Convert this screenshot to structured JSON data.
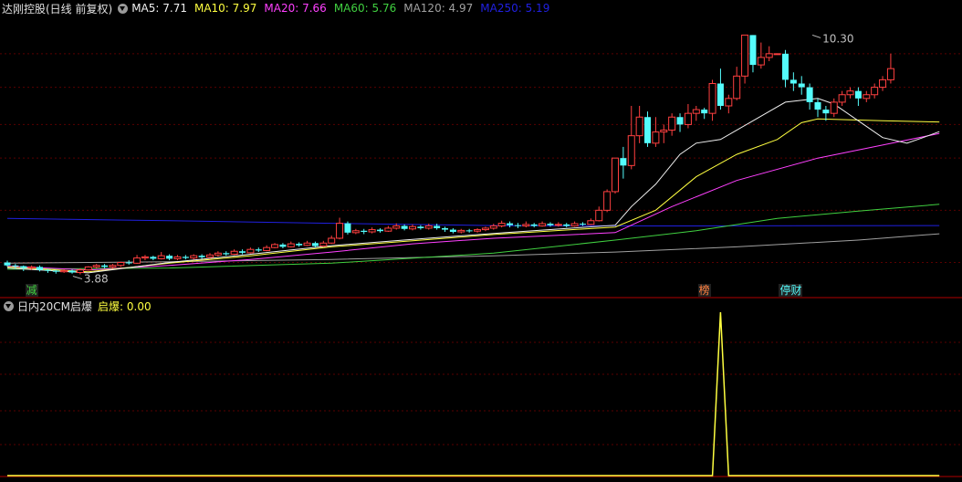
{
  "colors": {
    "background": "#000000",
    "grid": "#5a0000",
    "up": "#ff4040",
    "down": "#54fcfc",
    "ma5": "#f0f0f0",
    "ma10": "#ffff40",
    "ma20": "#ff40ff",
    "ma60": "#40d040",
    "ma120": "#a0a0a0",
    "ma250": "#2020e0",
    "indicator": "#ffff40"
  },
  "price_panel": {
    "title": "达刚控股(日线 前复权)",
    "legend": [
      {
        "key": "ma5",
        "label": "MA5: 7.71"
      },
      {
        "key": "ma10",
        "label": "MA10: 7.97"
      },
      {
        "key": "ma20",
        "label": "MA20: 7.66"
      },
      {
        "key": "ma60",
        "label": "MA60: 5.76"
      },
      {
        "key": "ma120",
        "label": "MA120: 4.97"
      },
      {
        "key": "ma250",
        "label": "MA250: 5.19"
      }
    ],
    "max_label": "10.30",
    "min_label": "3.88",
    "markers": [
      {
        "text": "减",
        "color": "#40d040",
        "bar": 3
      },
      {
        "text": "榜",
        "color": "#ff8040",
        "bar": 86
      },
      {
        "text": "停财",
        "color": "#54fcfc",
        "bar": 96
      }
    ]
  },
  "indicator_panel": {
    "title": "日内20CM启爆",
    "value_label": "启爆: 0.00"
  },
  "chart_data": [
    {
      "type": "candlestick",
      "title": "达刚控股(日线 前复权)",
      "ylim": [
        3.6,
        10.8
      ],
      "y_grid": [
        4.2,
        5.6,
        7.0,
        7.9,
        8.9,
        9.8
      ],
      "max_point": {
        "bar": 99,
        "value": 10.3
      },
      "min_point": {
        "bar": 9,
        "value": 3.88
      },
      "candles": [
        [
          4.2,
          4.12,
          4.25,
          4.08
        ],
        [
          4.12,
          4.1,
          4.16,
          4.03
        ],
        [
          4.1,
          4.05,
          4.12,
          3.97
        ],
        [
          4.05,
          4.08,
          4.12,
          4.0
        ],
        [
          4.08,
          4.0,
          4.12,
          3.96
        ],
        [
          4.0,
          3.98,
          4.02,
          3.92
        ],
        [
          3.98,
          3.95,
          4.0,
          3.9
        ],
        [
          3.95,
          3.98,
          4.02,
          3.92
        ],
        [
          3.98,
          3.93,
          4.01,
          3.9
        ],
        [
          3.93,
          4.0,
          4.04,
          3.88
        ],
        [
          4.0,
          4.08,
          4.1,
          3.98
        ],
        [
          4.08,
          4.12,
          4.16,
          4.04
        ],
        [
          4.12,
          4.08,
          4.16,
          4.04
        ],
        [
          4.08,
          4.12,
          4.16,
          4.04
        ],
        [
          4.12,
          4.2,
          4.22,
          4.08
        ],
        [
          4.2,
          4.18,
          4.26,
          4.14
        ],
        [
          4.18,
          4.32,
          4.4,
          4.16
        ],
        [
          4.32,
          4.35,
          4.4,
          4.26
        ],
        [
          4.35,
          4.3,
          4.38,
          4.26
        ],
        [
          4.3,
          4.38,
          4.48,
          4.28
        ],
        [
          4.38,
          4.3,
          4.42,
          4.26
        ],
        [
          4.3,
          4.35,
          4.4,
          4.26
        ],
        [
          4.35,
          4.32,
          4.4,
          4.28
        ],
        [
          4.32,
          4.38,
          4.42,
          4.28
        ],
        [
          4.38,
          4.34,
          4.42,
          4.3
        ],
        [
          4.34,
          4.4,
          4.45,
          4.3
        ],
        [
          4.4,
          4.45,
          4.5,
          4.36
        ],
        [
          4.45,
          4.42,
          4.5,
          4.38
        ],
        [
          4.42,
          4.5,
          4.55,
          4.4
        ],
        [
          4.5,
          4.46,
          4.55,
          4.42
        ],
        [
          4.46,
          4.55,
          4.6,
          4.44
        ],
        [
          4.55,
          4.52,
          4.6,
          4.48
        ],
        [
          4.52,
          4.6,
          4.66,
          4.5
        ],
        [
          4.6,
          4.68,
          4.72,
          4.58
        ],
        [
          4.68,
          4.62,
          4.72,
          4.58
        ],
        [
          4.62,
          4.7,
          4.76,
          4.6
        ],
        [
          4.7,
          4.66,
          4.74,
          4.62
        ],
        [
          4.66,
          4.72,
          4.78,
          4.64
        ],
        [
          4.72,
          4.64,
          4.76,
          4.6
        ],
        [
          4.64,
          4.72,
          4.78,
          4.62
        ],
        [
          4.72,
          4.85,
          4.92,
          4.7
        ],
        [
          4.85,
          5.25,
          5.4,
          4.82
        ],
        [
          5.25,
          5.0,
          5.3,
          4.95
        ],
        [
          5.0,
          5.05,
          5.1,
          4.96
        ],
        [
          5.05,
          5.02,
          5.1,
          4.96
        ],
        [
          5.02,
          5.08,
          5.14,
          4.98
        ],
        [
          5.08,
          5.04,
          5.12,
          5.0
        ],
        [
          5.04,
          5.12,
          5.18,
          5.02
        ],
        [
          5.12,
          5.18,
          5.25,
          5.08
        ],
        [
          5.18,
          5.1,
          5.22,
          5.06
        ],
        [
          5.1,
          5.16,
          5.22,
          5.06
        ],
        [
          5.16,
          5.12,
          5.2,
          5.08
        ],
        [
          5.12,
          5.18,
          5.24,
          5.08
        ],
        [
          5.18,
          5.12,
          5.24,
          5.08
        ],
        [
          5.12,
          5.08,
          5.16,
          5.02
        ],
        [
          5.08,
          5.02,
          5.12,
          4.98
        ],
        [
          5.02,
          5.06,
          5.1,
          4.98
        ],
        [
          5.06,
          5.04,
          5.1,
          5.0
        ],
        [
          5.04,
          5.08,
          5.12,
          5.0
        ],
        [
          5.08,
          5.12,
          5.16,
          5.04
        ],
        [
          5.12,
          5.18,
          5.24,
          5.08
        ],
        [
          5.18,
          5.25,
          5.32,
          5.14
        ],
        [
          5.25,
          5.2,
          5.3,
          5.14
        ],
        [
          5.2,
          5.18,
          5.26,
          5.12
        ],
        [
          5.18,
          5.22,
          5.3,
          5.14
        ],
        [
          5.22,
          5.18,
          5.26,
          5.14
        ],
        [
          5.18,
          5.24,
          5.3,
          5.16
        ],
        [
          5.24,
          5.2,
          5.28,
          5.16
        ],
        [
          5.2,
          5.22,
          5.28,
          5.16
        ],
        [
          5.22,
          5.18,
          5.26,
          5.14
        ],
        [
          5.18,
          5.24,
          5.3,
          5.16
        ],
        [
          5.24,
          5.22,
          5.28,
          5.18
        ],
        [
          5.22,
          5.32,
          5.38,
          5.2
        ],
        [
          5.32,
          5.6,
          5.7,
          5.3
        ],
        [
          5.6,
          6.1,
          6.16,
          5.55
        ],
        [
          6.1,
          7.0,
          7.0,
          6.05
        ],
        [
          7.0,
          6.8,
          7.3,
          6.45
        ],
        [
          6.8,
          7.6,
          8.4,
          6.7
        ],
        [
          7.6,
          8.1,
          8.4,
          7.4
        ],
        [
          8.1,
          7.4,
          8.25,
          7.3
        ],
        [
          7.4,
          7.7,
          8.1,
          7.3
        ],
        [
          7.7,
          7.75,
          7.9,
          7.4
        ],
        [
          7.75,
          8.1,
          8.2,
          7.6
        ],
        [
          8.1,
          7.9,
          8.2,
          7.7
        ],
        [
          7.9,
          8.2,
          8.45,
          7.8
        ],
        [
          8.2,
          8.3,
          8.4,
          8.0
        ],
        [
          8.3,
          8.2,
          8.35,
          8.05
        ],
        [
          8.2,
          9.0,
          9.1,
          8.0
        ],
        [
          9.0,
          8.4,
          9.4,
          8.3
        ],
        [
          8.4,
          8.6,
          8.7,
          8.2
        ],
        [
          8.6,
          9.2,
          9.45,
          8.55
        ],
        [
          9.2,
          10.3,
          10.3,
          9.0
        ],
        [
          10.3,
          9.5,
          10.3,
          9.3
        ],
        [
          9.5,
          9.7,
          10.1,
          9.4
        ],
        [
          9.7,
          9.8,
          10.0,
          9.6
        ],
        [
          9.8,
          9.8,
          9.8,
          9.8
        ],
        [
          9.8,
          9.1,
          9.9,
          8.9
        ],
        [
          9.1,
          9.0,
          9.3,
          8.8
        ],
        [
          9.0,
          8.9,
          9.2,
          8.7
        ],
        [
          8.9,
          8.5,
          9.0,
          8.3
        ],
        [
          8.5,
          8.3,
          8.6,
          8.1
        ],
        [
          8.3,
          8.2,
          8.4,
          8.0
        ],
        [
          8.2,
          8.5,
          8.6,
          8.1
        ],
        [
          8.5,
          8.7,
          8.8,
          8.4
        ],
        [
          8.7,
          8.8,
          8.9,
          8.6
        ],
        [
          8.8,
          8.6,
          8.9,
          8.4
        ],
        [
          8.6,
          8.7,
          8.8,
          8.5
        ],
        [
          8.7,
          8.9,
          9.0,
          8.6
        ],
        [
          8.9,
          9.1,
          9.2,
          8.8
        ],
        [
          9.1,
          9.4,
          9.8,
          9.0
        ]
      ],
      "ma_series": [
        {
          "name": "MA250",
          "key": "ma250",
          "points": [
            [
              0,
              5.38
            ],
            [
              20,
              5.32
            ],
            [
              40,
              5.25
            ],
            [
              60,
              5.19
            ],
            [
              80,
              5.18
            ],
            [
              115,
              5.19
            ]
          ]
        },
        {
          "name": "MA120",
          "key": "ma120",
          "points": [
            [
              0,
              4.18
            ],
            [
              20,
              4.22
            ],
            [
              40,
              4.28
            ],
            [
              60,
              4.38
            ],
            [
              75,
              4.48
            ],
            [
              90,
              4.62
            ],
            [
              105,
              4.8
            ],
            [
              115,
              4.97
            ]
          ]
        },
        {
          "name": "MA60",
          "key": "ma60",
          "points": [
            [
              0,
              4.02
            ],
            [
              20,
              4.05
            ],
            [
              40,
              4.18
            ],
            [
              60,
              4.45
            ],
            [
              75,
              4.8
            ],
            [
              85,
              5.05
            ],
            [
              95,
              5.38
            ],
            [
              105,
              5.58
            ],
            [
              115,
              5.76
            ]
          ]
        },
        {
          "name": "MA20",
          "key": "ma20",
          "points": [
            [
              0,
              4.1
            ],
            [
              10,
              4.0
            ],
            [
              20,
              4.12
            ],
            [
              30,
              4.28
            ],
            [
              40,
              4.48
            ],
            [
              50,
              4.7
            ],
            [
              60,
              4.85
            ],
            [
              75,
              5.0
            ],
            [
              82,
              5.7
            ],
            [
              90,
              6.4
            ],
            [
              100,
              7.0
            ],
            [
              108,
              7.35
            ],
            [
              115,
              7.66
            ]
          ]
        },
        {
          "name": "MA10",
          "key": "ma10",
          "points": [
            [
              0,
              4.08
            ],
            [
              10,
              3.95
            ],
            [
              20,
              4.18
            ],
            [
              30,
              4.38
            ],
            [
              40,
              4.62
            ],
            [
              50,
              4.78
            ],
            [
              60,
              4.95
            ],
            [
              75,
              5.15
            ],
            [
              80,
              5.6
            ],
            [
              85,
              6.5
            ],
            [
              90,
              7.1
            ],
            [
              95,
              7.5
            ],
            [
              98,
              7.95
            ],
            [
              100,
              8.05
            ],
            [
              108,
              8.0
            ],
            [
              115,
              7.97
            ]
          ]
        },
        {
          "name": "MA5",
          "key": "ma5",
          "points": [
            [
              0,
              4.05
            ],
            [
              10,
              3.92
            ],
            [
              20,
              4.2
            ],
            [
              30,
              4.42
            ],
            [
              40,
              4.65
            ],
            [
              50,
              4.82
            ],
            [
              60,
              4.98
            ],
            [
              75,
              5.2
            ],
            [
              77,
              5.7
            ],
            [
              80,
              6.3
            ],
            [
              83,
              7.1
            ],
            [
              85,
              7.4
            ],
            [
              88,
              7.5
            ],
            [
              92,
              8.0
            ],
            [
              96,
              8.5
            ],
            [
              100,
              8.6
            ],
            [
              102,
              8.45
            ],
            [
              105,
              8.0
            ],
            [
              108,
              7.55
            ],
            [
              111,
              7.4
            ],
            [
              113,
              7.55
            ],
            [
              115,
              7.71
            ]
          ]
        }
      ]
    },
    {
      "type": "line",
      "title": "日内20CM启爆",
      "series": [
        {
          "name": "启爆",
          "values": [
            [
              0,
              0
            ],
            [
              87,
              0
            ],
            [
              88,
              1
            ],
            [
              89,
              0
            ],
            [
              115,
              0
            ]
          ]
        }
      ],
      "ylim": [
        0,
        1
      ]
    }
  ]
}
